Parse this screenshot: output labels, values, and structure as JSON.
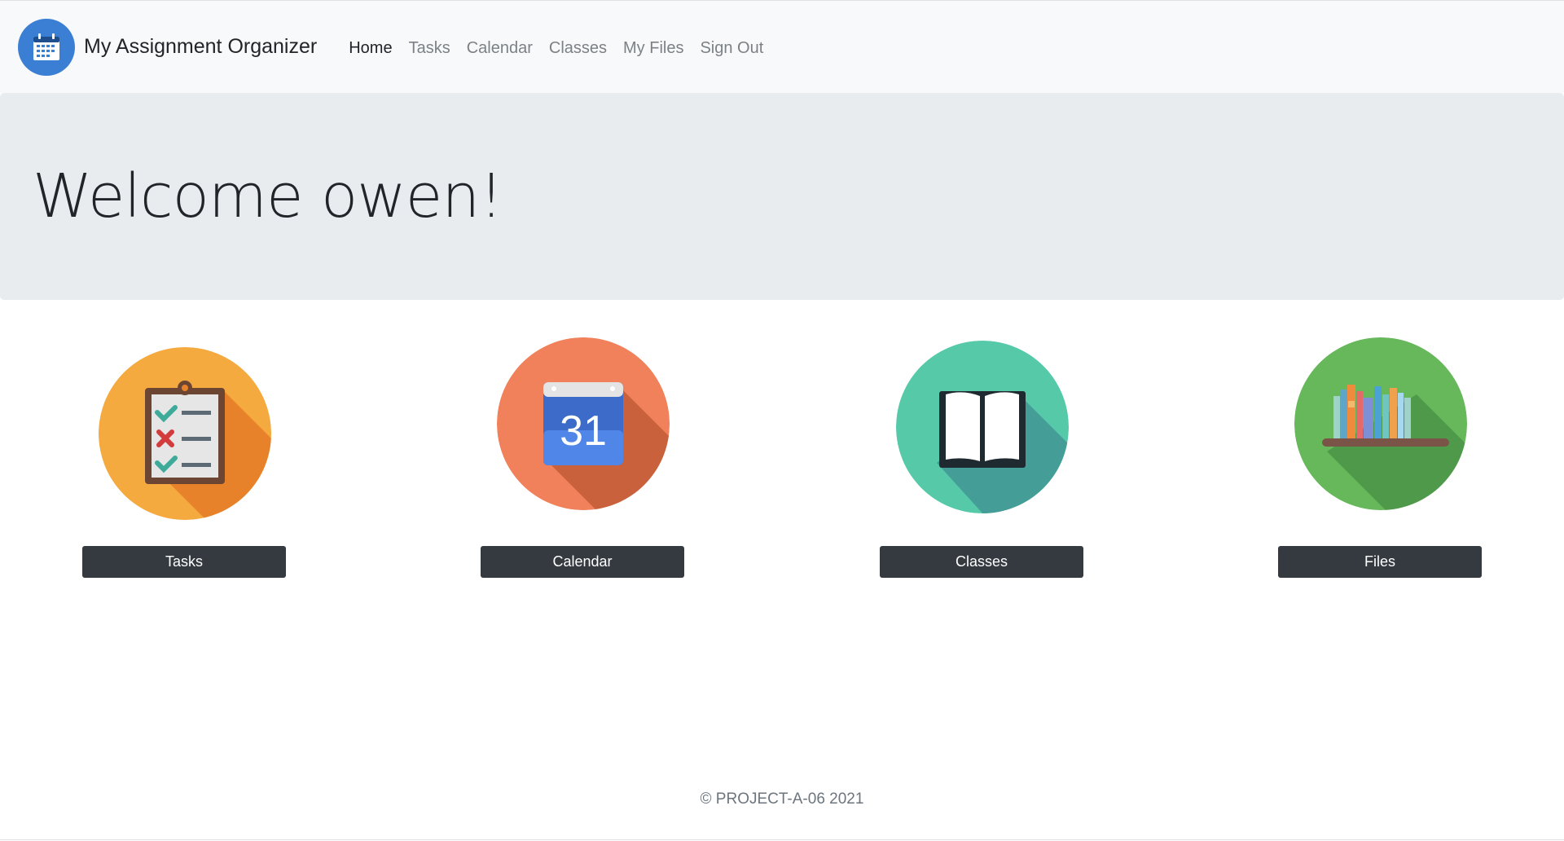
{
  "navbar": {
    "brand_title": "My Assignment Organizer",
    "brand_icon": "calendar-icon",
    "links": [
      {
        "label": "Home",
        "active": true
      },
      {
        "label": "Tasks",
        "active": false
      },
      {
        "label": "Calendar",
        "active": false
      },
      {
        "label": "Classes",
        "active": false
      },
      {
        "label": "My Files",
        "active": false
      },
      {
        "label": "Sign Out",
        "active": false
      }
    ]
  },
  "jumbotron": {
    "welcome": "Welcome owen!"
  },
  "cards": [
    {
      "button_label": "Tasks",
      "icon": "checklist-icon",
      "color": "#f4aa3e"
    },
    {
      "button_label": "Calendar",
      "icon": "calendar-31-icon",
      "color": "#f0815a",
      "date_number": "31"
    },
    {
      "button_label": "Classes",
      "icon": "open-book-icon",
      "color": "#55c9a8"
    },
    {
      "button_label": "Files",
      "icon": "bookshelf-icon",
      "color": "#66b85b"
    }
  ],
  "footer": {
    "copyright": "© PROJECT-A-06 2021"
  },
  "colors": {
    "navbar_bg": "#f8f9fa",
    "jumbotron_bg": "#e9ecef",
    "button_bg": "#343a40",
    "brand_logo": "#3b7fd4"
  }
}
